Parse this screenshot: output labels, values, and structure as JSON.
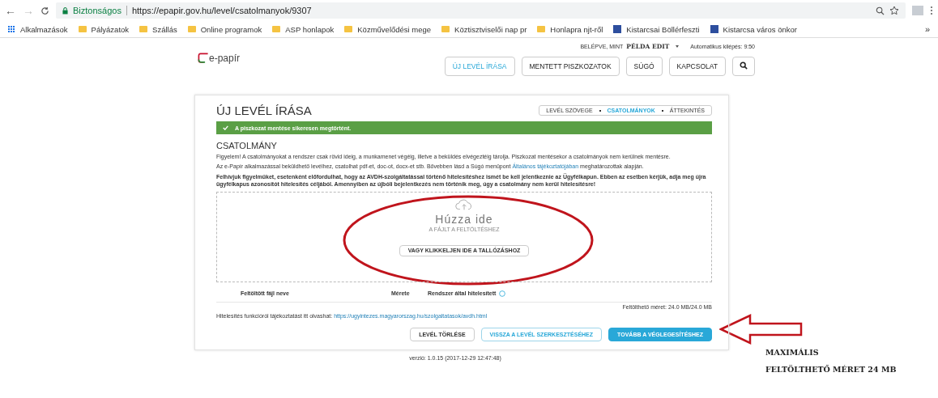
{
  "browser": {
    "back": "←",
    "forward": "→",
    "secure_label": "Biztonságos",
    "url": "https://epapir.gov.hu/level/csatolmanyok/9307",
    "bookmarks": [
      {
        "label": "Alkalmazások",
        "kind": "apps"
      },
      {
        "label": "Pályázatok",
        "kind": "folder"
      },
      {
        "label": "Szállás",
        "kind": "folder"
      },
      {
        "label": "Online programok",
        "kind": "folder"
      },
      {
        "label": "ASP honlapok",
        "kind": "folder"
      },
      {
        "label": "Közművelődési mege",
        "kind": "folder"
      },
      {
        "label": "Köztisztviselői nap pr",
        "kind": "folder"
      },
      {
        "label": "Honlapra njt-ről",
        "kind": "folder"
      },
      {
        "label": "Kistarcsai Böllérfeszti",
        "kind": "site"
      },
      {
        "label": "Kistarcsa város önkor",
        "kind": "site"
      }
    ],
    "more": "»"
  },
  "header": {
    "logo": "e-papír",
    "user_label": "BELÉPVE, MINT",
    "user_name": "PÉLDA EDIT",
    "auto_logout": "Automatikus kilépés: 9:50",
    "nav": [
      {
        "label": "ÚJ LEVÉL ÍRÁSA",
        "selected": true
      },
      {
        "label": "MENTETT PISZKOZATOK",
        "selected": false
      },
      {
        "label": "SÚGÓ",
        "selected": false
      },
      {
        "label": "KAPCSOLAT",
        "selected": false
      }
    ]
  },
  "card": {
    "title": "ÚJ LEVÉL ÍRÁSA",
    "steps": [
      {
        "label": "LEVÉL SZÖVEGE",
        "selected": false
      },
      {
        "label": "CSATOLMÁNYOK",
        "selected": true
      },
      {
        "label": "ÁTTEKINTÉS",
        "selected": false
      }
    ],
    "alert": "A piszkozat mentése sikeresen megtörtént.",
    "section_title": "CSATOLMÁNY",
    "notice": "Figyelem! A csatolmányokat a rendszer csak rövid ideig, a munkamenet végéig, illetve a beküldés elvégeztéig tárolja. Piszkozat mentésekor a csatolmányok nem kerülnek mentésre.",
    "info_before": "Az e-Papír alkalmazással beküldhető levélhez, csatolhat pdf-et, doc-ot, docx-et stb. Bővebben lásd a Súgó menüpont",
    "info_link": "Általános tájékoztatójában",
    "info_after": "meghatározottak alapján.",
    "warning": "Felhívjuk figyelmüket, esetenként előfordulhat, hogy az AVDH-szolgáltatással történő hitelesítéshez ismét be kell jelentkeznie az Ügyfélkapun. Ebben az esetben kérjük, adja meg újra ügyfélkapus azonosítót hitelesítés céljából. Amennyiben az újbóli bejelentkezés nem történik meg, úgy a csatolmány nem kerül hitelesítésre!",
    "dropzone": {
      "title": "Húzza ide",
      "subtitle": "A FÁJLT A FELTÖLTÉSHEZ",
      "button": "VAGY KLIKKELJEN IDE A TALLÓZÁSHOZ"
    },
    "table": {
      "columns": [
        "Feltöltött fájl neve",
        "Mérete",
        "Rendszer által hitelesített"
      ]
    },
    "upload_limit": "Feltölthető méret: 24.0 MB/24.0 MB",
    "auth_info": "Hitelesítés funkcióról tájékoztatást itt olvashat:",
    "auth_link": "https://ugyintezes.magyarorszag.hu/szolgaltatasok/avdh.html",
    "buttons": [
      {
        "label": "LEVÉL TÖRLÉSE",
        "kind": "plain"
      },
      {
        "label": "VISSZA A LEVÉL SZERKESZTÉSÉHEZ",
        "kind": "outline"
      },
      {
        "label": "TOVÁBB A VÉGLEGESÍTÉSHEZ",
        "kind": "primary"
      }
    ]
  },
  "version": "verzió: 1.0.15 (2017-12-29 12:47:48)",
  "annotation": {
    "lines": [
      "MAXIMÁLIS",
      "FELTÖLTHETŐ MÉRET 24 MB"
    ]
  }
}
